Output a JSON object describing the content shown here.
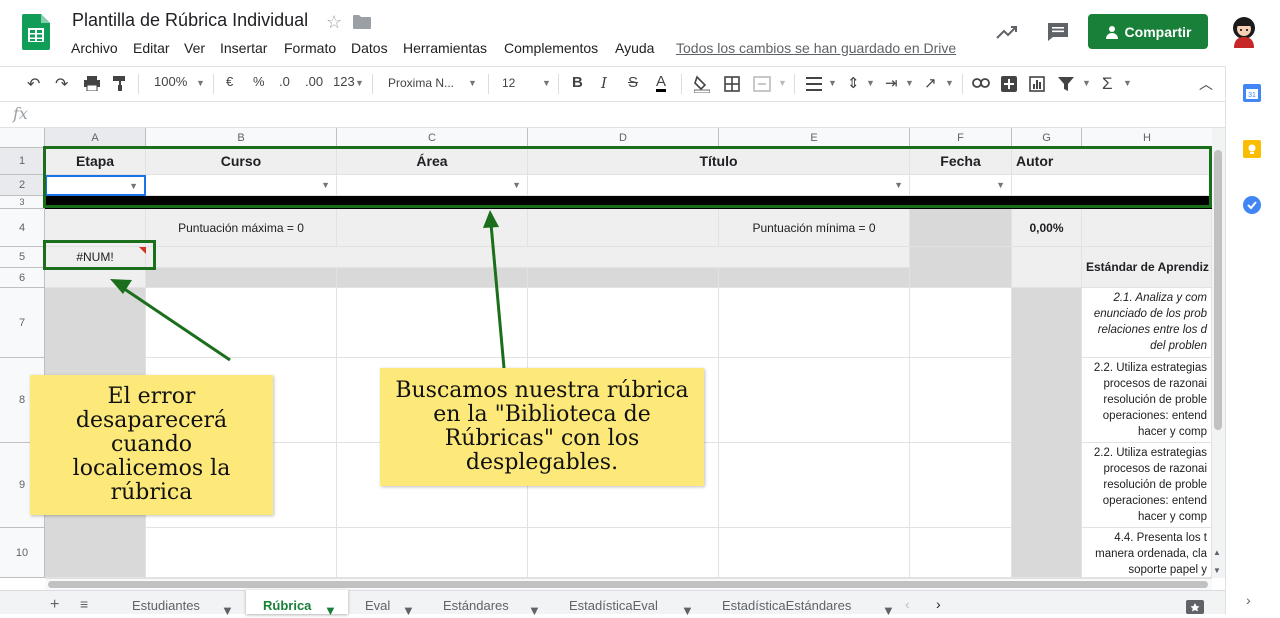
{
  "app": {
    "doc_title": "Plantilla de Rúbrica Individual",
    "menus": [
      "Archivo",
      "Editar",
      "Ver",
      "Insertar",
      "Formato",
      "Datos",
      "Herramientas",
      "Complementos",
      "Ayuda"
    ],
    "saved_status": "Todos los cambios se han guardado en Drive",
    "share_label": "Compartir",
    "brand_color": "#188038"
  },
  "toolbar": {
    "zoom": "100%",
    "currency": "€",
    "percent": "%",
    "dec_less": ".0",
    "dec_more": ".00",
    "more_formats": "123",
    "font": "Proxima N...",
    "font_size": "12",
    "bold": "B",
    "italic": "I",
    "strike": "S",
    "text_color": "A"
  },
  "formula_bar": {
    "fx": "fx"
  },
  "columns": [
    "A",
    "B",
    "C",
    "D",
    "E",
    "F",
    "G",
    "H"
  ],
  "rows": [
    "1",
    "2",
    "3",
    "4",
    "5",
    "6",
    "7",
    "8",
    "9",
    "10"
  ],
  "sheet": {
    "headers": {
      "etapa": "Etapa",
      "curso": "Curso",
      "area": "Área",
      "titulo": "Título",
      "fecha": "Fecha",
      "autor": "Autor"
    },
    "max_score": "Puntuación máxima = 0",
    "min_score": "Puntuación mínima = 0",
    "percent": "0,00%",
    "error": "#NUM!",
    "standards_header": "Estándar de Aprendiz",
    "standards": [
      [
        "2.1. Analiza y com",
        "enunciado de los prob",
        "relaciones entre los d",
        "del problen"
      ],
      [
        "2.2. Utiliza estrategias",
        "procesos de razonai",
        "resolución de proble",
        "operaciones: entend",
        "hacer y comp"
      ],
      [
        "2.2. Utiliza estrategias",
        "procesos de razonai",
        "resolución de proble",
        "operaciones: entend",
        "hacer y comp"
      ],
      [
        "4.4. Presenta los t",
        "manera ordenada, cla",
        "soporte papel y"
      ]
    ]
  },
  "annotations": {
    "error_callout": "El error desaparecerá cuando localicemos la rúbrica",
    "search_callout": "Buscamos nuestra rúbrica en la \"Biblioteca de Rúbricas\" con los desplegables.",
    "highlight_color": "#1b6e1b",
    "callout_color": "#fde87a"
  },
  "tabs": [
    "Estudiantes",
    "Rúbrica",
    "Eval",
    "Estándares",
    "EstadísticaEval",
    "EstadísticaEstándares"
  ],
  "active_tab": "Rúbrica"
}
